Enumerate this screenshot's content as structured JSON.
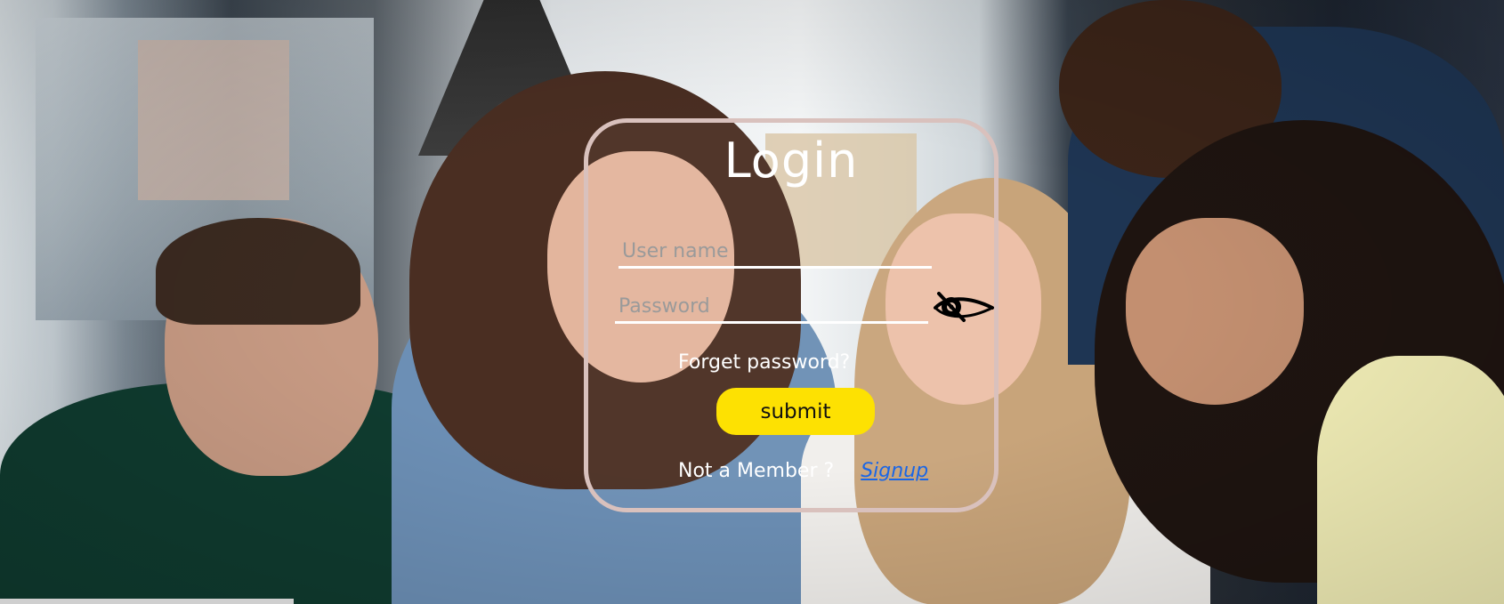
{
  "login": {
    "title": "Login",
    "username_placeholder": "User name",
    "password_placeholder": "Password",
    "forgot_label": "Forget password?",
    "submit_label": "submit",
    "not_member_label": "Not a Member ?",
    "signup_label": "Signup"
  },
  "icons": {
    "password_toggle": "eye-slash-icon"
  },
  "colors": {
    "card_border": "#d9c1bd",
    "submit_bg": "#fde102",
    "signup_link": "#1a66e6",
    "text": "#ffffff"
  }
}
